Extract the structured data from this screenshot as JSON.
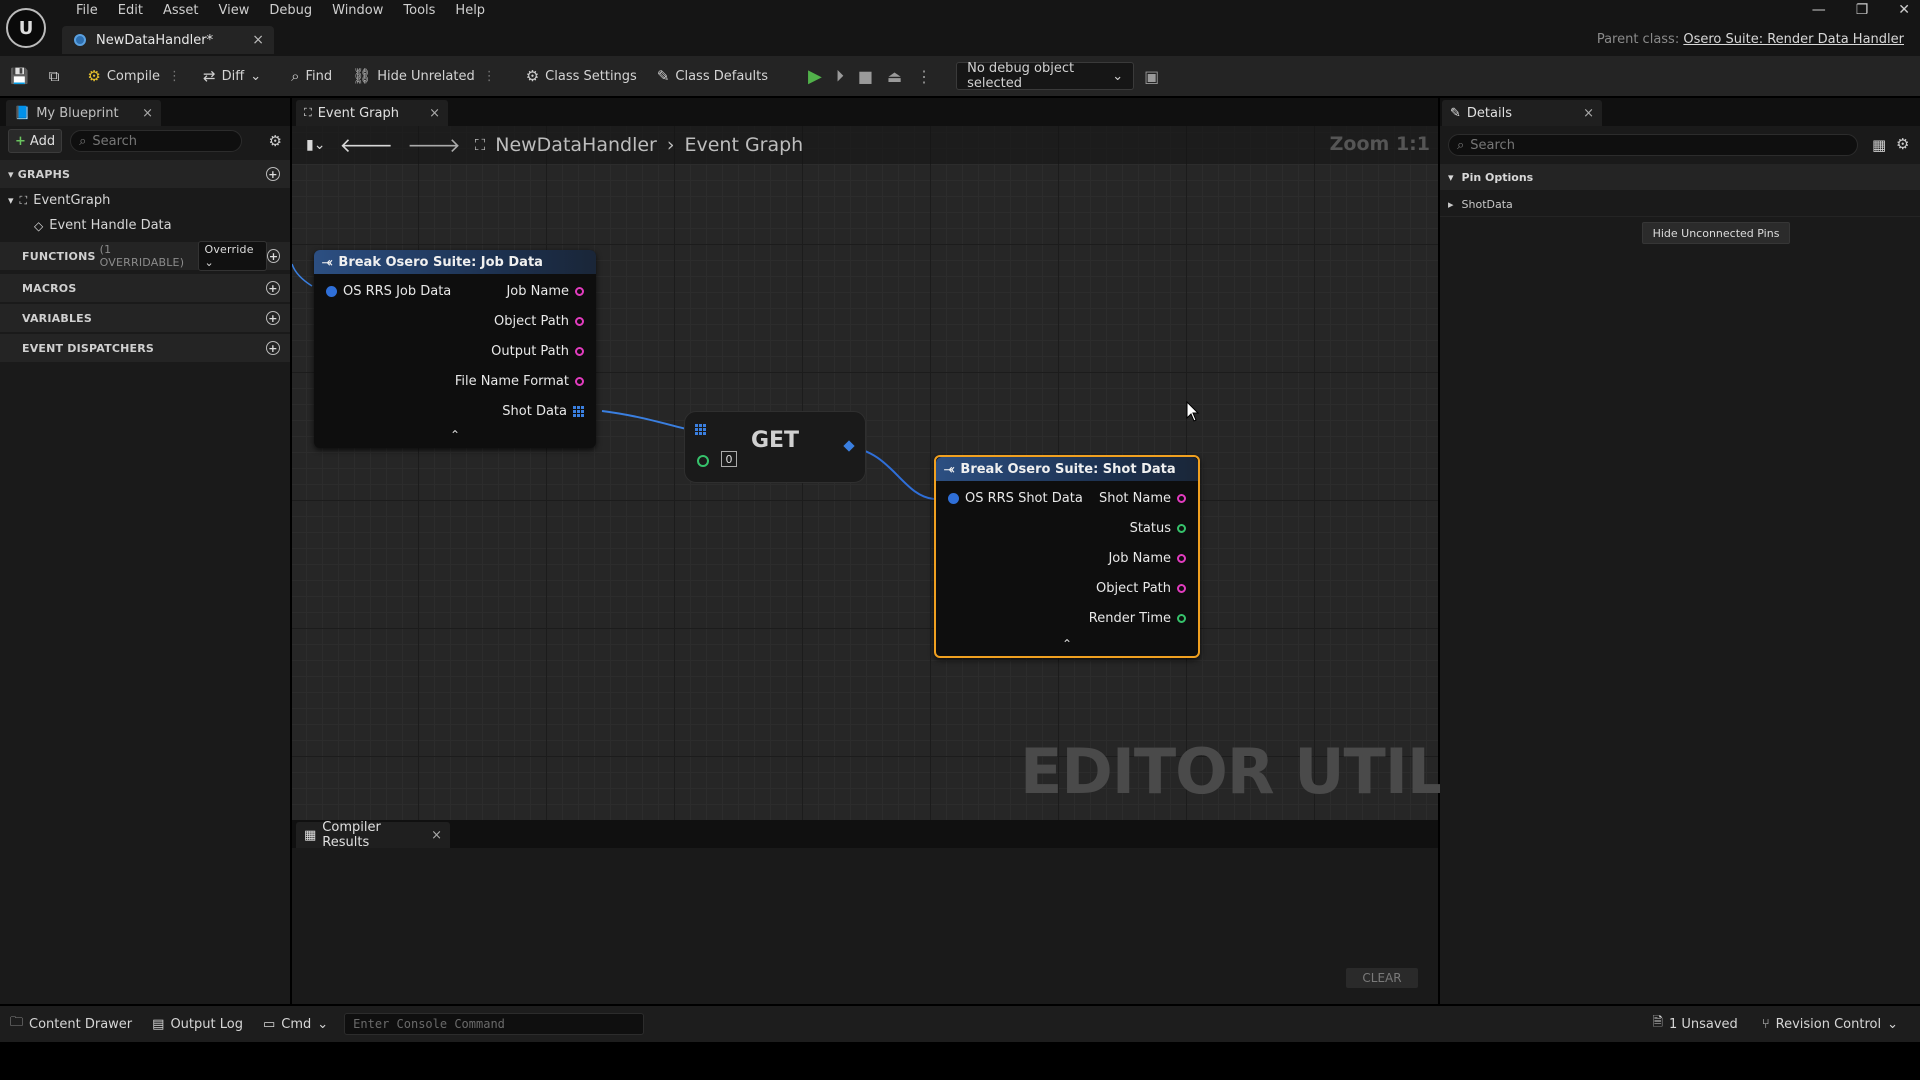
{
  "menu": [
    "File",
    "Edit",
    "Asset",
    "View",
    "Debug",
    "Window",
    "Tools",
    "Help"
  ],
  "document_tab": {
    "label": "NewDataHandler*"
  },
  "parent_class": {
    "label": "Parent class:",
    "value": "Osero Suite: Render Data Handler"
  },
  "toolbar": {
    "compile": "Compile",
    "diff": "Diff",
    "find": "Find",
    "hide_unrelated": "Hide Unrelated",
    "class_settings": "Class Settings",
    "class_defaults": "Class Defaults",
    "debug_select": "No debug object selected"
  },
  "my_blueprint": {
    "tab": "My Blueprint",
    "add": "Add",
    "search_placeholder": "Search",
    "graphs_header": "GRAPHS",
    "event_graph": "EventGraph",
    "event_handle_data": "Event Handle Data",
    "functions_header": "FUNCTIONS",
    "functions_note": "(1 OVERRIDABLE)",
    "override": "Override",
    "macros_header": "MACROS",
    "variables_header": "VARIABLES",
    "dispatchers_header": "EVENT DISPATCHERS"
  },
  "graph": {
    "tab": "Event Graph",
    "breadcrumb_root": "NewDataHandler",
    "breadcrumb_leaf": "Event Graph",
    "zoom": "Zoom 1:1",
    "watermark": "EDITOR UTILITY",
    "job_node": {
      "title": "Break Osero Suite: Job Data",
      "input": "OS RRS Job Data",
      "outputs": [
        "Job Name",
        "Object Path",
        "Output Path",
        "File Name Format",
        "Shot Data"
      ]
    },
    "get_node": {
      "title": "GET",
      "index": "0"
    },
    "shot_node": {
      "title": "Break Osero Suite: Shot Data",
      "input": "OS RRS Shot Data",
      "outputs": [
        "Shot Name",
        "Status",
        "Job Name",
        "Object Path",
        "Render Time"
      ]
    }
  },
  "compiler": {
    "tab": "Compiler Results",
    "clear": "CLEAR"
  },
  "details": {
    "tab": "Details",
    "search_placeholder": "Search",
    "pin_options": "Pin Options",
    "shot_data": "ShotData",
    "hide_unconnected": "Hide Unconnected Pins"
  },
  "statusbar": {
    "content_drawer": "Content Drawer",
    "output_log": "Output Log",
    "cmd": "Cmd",
    "console_placeholder": "Enter Console Command",
    "unsaved": "1 Unsaved",
    "revision_control": "Revision Control"
  },
  "colors": {
    "pin_string": "#e23cbf",
    "pin_bool": "#36c26b",
    "pin_struct": "#2f6fd8",
    "selection": "#f0a020",
    "play": "#51b14a"
  }
}
